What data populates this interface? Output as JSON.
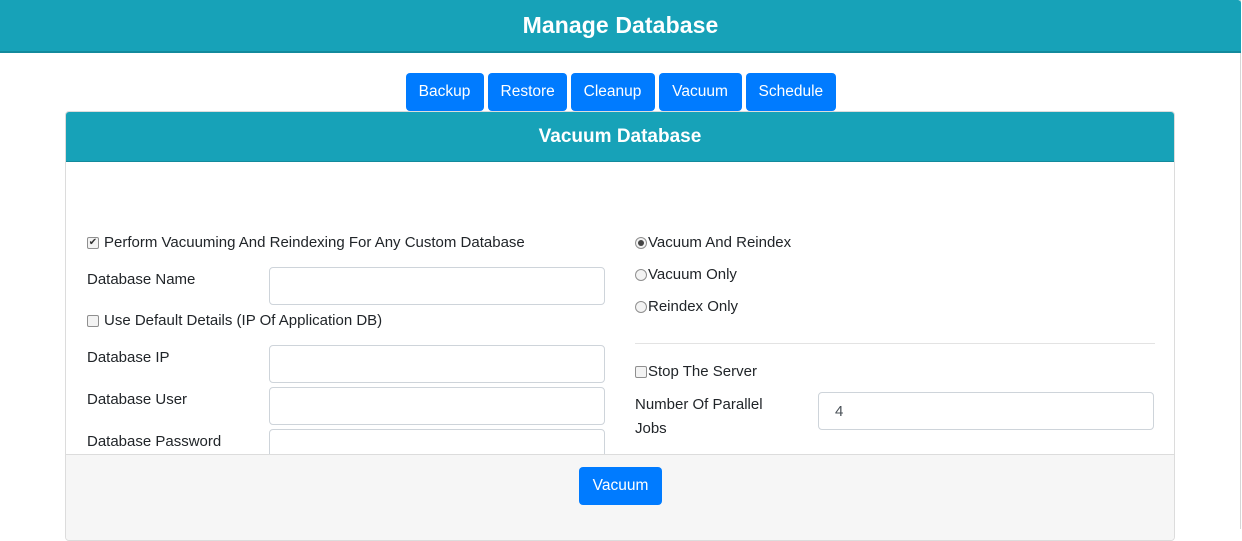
{
  "header": {
    "title": "Manage Database"
  },
  "tabs": [
    {
      "label": "Backup"
    },
    {
      "label": "Restore"
    },
    {
      "label": "Cleanup"
    },
    {
      "label": "Vacuum"
    },
    {
      "label": "Schedule"
    }
  ],
  "card": {
    "title": "Vacuum Database",
    "left": {
      "custom_db_checkbox": {
        "label": "Perform Vacuuming And Reindexing For Any Custom Database",
        "checked": true
      },
      "database_name": {
        "label": "Database Name",
        "value": ""
      },
      "use_default_checkbox": {
        "label": "Use Default Details (IP Of Application DB)",
        "checked": false
      },
      "database_ip": {
        "label": "Database IP",
        "value": ""
      },
      "database_user": {
        "label": "Database User",
        "value": ""
      },
      "database_password": {
        "label": "Database Password",
        "value": ""
      }
    },
    "right": {
      "mode_options": [
        {
          "label": "Vacuum And Reindex",
          "selected": true
        },
        {
          "label": "Vacuum Only",
          "selected": false
        },
        {
          "label": "Reindex Only",
          "selected": false
        }
      ],
      "stop_server_checkbox": {
        "label": "Stop The Server",
        "checked": false
      },
      "parallel_jobs": {
        "label_line1": "Number Of Parallel",
        "label_line2": "Jobs",
        "value": "4"
      }
    },
    "submit_label": "Vacuum"
  },
  "icons": {
    "checkmark": "✔"
  }
}
